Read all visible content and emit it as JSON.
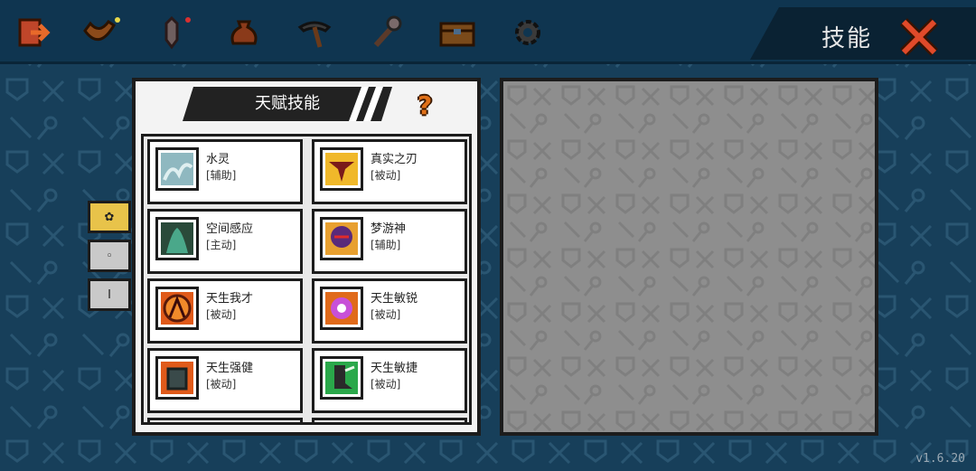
{
  "header": {
    "title": "技能",
    "nav_icons": [
      "exit-door-icon",
      "boomerang-icon",
      "dagger-icon",
      "pouch-icon",
      "pickaxe-icon",
      "torch-icon",
      "treasure-chest-icon",
      "gear-icon"
    ]
  },
  "panel": {
    "title": "天赋技能",
    "help": "?"
  },
  "side_tabs": [
    {
      "label": "✿",
      "active": true
    },
    {
      "label": "◦",
      "active": false
    },
    {
      "label": "I",
      "active": false
    }
  ],
  "skills": [
    {
      "name": "水灵",
      "type": "[辅助]",
      "icon": "water-spirit-icon"
    },
    {
      "name": "真实之刃",
      "type": "[被动]",
      "icon": "blade-icon"
    },
    {
      "name": "空间感应",
      "type": "[主动]",
      "icon": "space-sense-icon"
    },
    {
      "name": "梦游神",
      "type": "[辅助]",
      "icon": "dream-walker-icon"
    },
    {
      "name": "天生我才",
      "type": "[被动]",
      "icon": "talent-icon"
    },
    {
      "name": "天生敏锐",
      "type": "[被动]",
      "icon": "keen-icon"
    },
    {
      "name": "天生强健",
      "type": "[被动]",
      "icon": "armor-icon"
    },
    {
      "name": "天生敏捷",
      "type": "[被动]",
      "icon": "agility-icon"
    }
  ],
  "version": "v1.6.20",
  "colors": {
    "background": "#173f5a",
    "panel": "#f3f3f3",
    "detail_panel": "#8e8e8e",
    "accent": "#e8c34a",
    "close": "#e04a2a"
  }
}
